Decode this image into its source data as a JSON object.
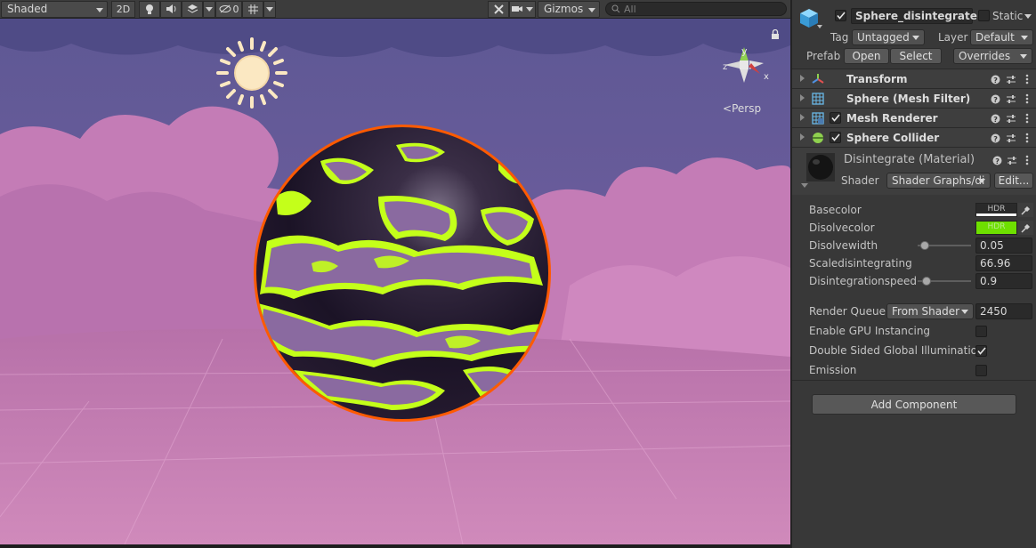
{
  "scene": {
    "toolbar": {
      "shading_mode": "Shaded",
      "btn_2d": "2D",
      "hidden_count": "0",
      "gizmos": "Gizmos",
      "search_placeholder": "All"
    },
    "gizmo": {
      "axis_y": "y",
      "axis_z": "z",
      "axis_x": "x",
      "projection_label": "Persp"
    },
    "colors": {
      "sky_top": "#6a5a9c",
      "cloud": "#c780b8",
      "ground": "#c97fb4",
      "sphere_dark": "#1c1428",
      "pattern_purple": "#8a6aa0",
      "pattern_lime": "#c4ff1a",
      "rim": "#ff5a00"
    }
  },
  "inspector": {
    "object_name": "Sphere_disintegrate",
    "active_checked": true,
    "static_label": "Static",
    "static_checked": false,
    "tag_label": "Tag",
    "tag_value": "Untagged",
    "layer_label": "Layer",
    "layer_value": "Default",
    "prefab_label": "Prefab",
    "open_label": "Open",
    "select_label": "Select",
    "overrides_label": "Overrides",
    "components": [
      {
        "name": "Transform",
        "icon": "transform-icon",
        "has_checkbox": false
      },
      {
        "name": "Sphere (Mesh Filter)",
        "icon": "mesh-filter-icon",
        "has_checkbox": false
      },
      {
        "name": "Mesh Renderer",
        "icon": "mesh-renderer-icon",
        "has_checkbox": true
      },
      {
        "name": "Sphere Collider",
        "icon": "sphere-collider-icon",
        "has_checkbox": true
      }
    ],
    "material": {
      "title": "Disintegrate (Material)",
      "shader_label": "Shader",
      "shader_value": "Shader Graphs/di",
      "edit_label": "Edit...",
      "properties": {
        "basecolor": {
          "label": "Basecolor",
          "hdr": "HDR",
          "color": "#ffffff"
        },
        "disolvecolor": {
          "label": "Disolvecolor",
          "hdr": "HDR",
          "color": "#6ee000"
        },
        "disolvewidth": {
          "label": "Disolvewidth",
          "value": "0.05",
          "slider_fraction": 0.05
        },
        "scaledisintegrating": {
          "label": "Scaledisintegrating",
          "value": "66.96"
        },
        "disintegrationspeed": {
          "label": "Disintegrationspeed",
          "value": "0.9",
          "slider_fraction": 0.09
        }
      },
      "render_queue_label": "Render Queue",
      "render_queue_mode": "From Shader",
      "render_queue_value": "2450",
      "gpu_instancing_label": "Enable GPU Instancing",
      "gpu_instancing_checked": false,
      "double_sided_gi_label": "Double Sided Global Illumination",
      "double_sided_gi_checked": true,
      "emission_label": "Emission",
      "emission_checked": false
    },
    "add_component_label": "Add Component"
  }
}
